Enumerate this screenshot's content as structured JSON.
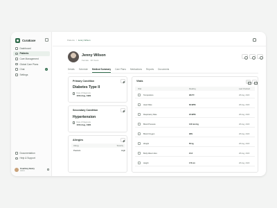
{
  "app": {
    "name": "CuraEase"
  },
  "sidebar": {
    "items": [
      {
        "label": "Dashboard",
        "icon": "grid-icon",
        "active": false
      },
      {
        "label": "Patients",
        "icon": "users-icon",
        "active": true
      },
      {
        "label": "Care Management",
        "icon": "heart-icon",
        "active": false
      },
      {
        "label": "Global Care Plans",
        "icon": "globe-icon",
        "active": false
      },
      {
        "label": "Chat",
        "icon": "chat-icon",
        "active": false,
        "badge": "2"
      },
      {
        "label": "Settings",
        "icon": "gear-icon",
        "active": false
      }
    ],
    "bottom_items": [
      {
        "label": "Documentation",
        "icon": "book-icon"
      },
      {
        "label": "Help & Support",
        "icon": "help-icon"
      }
    ],
    "user": {
      "name": "Courtney Henry",
      "role": "Admin"
    }
  },
  "breadcrumb": {
    "parent": "Patients",
    "separator": "/",
    "current": "Jenny Wilson"
  },
  "patient": {
    "name": "Jenny Wilson",
    "meta": "Female · 36 Years"
  },
  "tabs": [
    "Details",
    "Schedule",
    "Medical Summary",
    "Care Plans",
    "Medications",
    "Reports",
    "Documents"
  ],
  "active_tab": "Medical Summary",
  "primary_condition": {
    "title": "Primary Condition",
    "condition": "Diabetes Type II",
    "date_label": "Date of Diagnosis",
    "date": "10th Aug, 1981"
  },
  "secondary_condition": {
    "title": "Secondary Condition",
    "condition": "Hypertension",
    "date_label": "Date of Diagnosis",
    "date": "10th Aug, 1981"
  },
  "allergies": {
    "title": "Allergies",
    "headers": [
      "Allergy",
      "Severity"
    ],
    "rows": [
      {
        "allergy": "Peanuts",
        "severity": "High"
      }
    ]
  },
  "vitals": {
    "title": "Vitals",
    "headers": [
      "Vital",
      "Reading",
      "Last Checked"
    ],
    "rows": [
      {
        "name": "Temperature",
        "reading": "98.6°F",
        "date": "28 Aug, 2023"
      },
      {
        "name": "Heart Rate",
        "reading": "82 BPM",
        "date": "28 Aug, 2023"
      },
      {
        "name": "Respiratory Rate",
        "reading": "22 BPM",
        "date": "28 Aug, 2023"
      },
      {
        "name": "Blood Pressure",
        "reading": "120 mm Hg",
        "date": "28 Aug, 2023"
      },
      {
        "name": "Blood Oxygen",
        "reading": "98%",
        "date": "28 Aug, 2023"
      },
      {
        "name": "Weight",
        "reading": "65 kg",
        "date": "28 Aug, 2023"
      },
      {
        "name": "Body Mass Index",
        "reading": "21.6",
        "date": "28 Aug, 2023"
      },
      {
        "name": "Height",
        "reading": "170 cm",
        "date": "28 Aug, 2023"
      }
    ]
  },
  "colors": {
    "accent": "#2f6b4b",
    "background": "#f3f4f3"
  }
}
